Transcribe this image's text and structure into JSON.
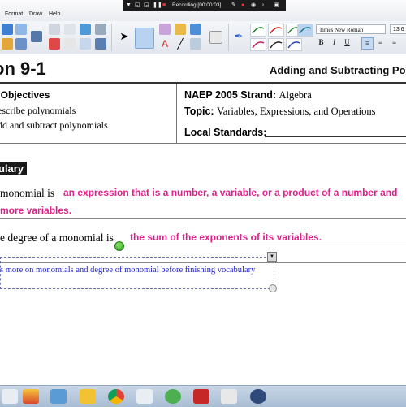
{
  "menubar": {
    "items": [
      "Format",
      "Draw",
      "Help"
    ]
  },
  "recording": {
    "status": "Recording [00:00:03]"
  },
  "toolbar": {
    "font_name": "Times New Roman",
    "font_size": "13.6",
    "bold": "B",
    "italic": "I",
    "underline": "U"
  },
  "worksheet": {
    "lesson_title": "on 9-1",
    "lesson_subtitle": "Adding and Subtracting Po",
    "objectives_heading": "n Objectives",
    "objective_1": "escribe polynomials",
    "objective_2": "dd and subtract polynomials",
    "naep_label": "NAEP 2005 Strand:",
    "naep_value": "Algebra",
    "topic_label": "Topic:",
    "topic_value": "Variables, Expressions, and Operations",
    "local_label": "Local Standards:",
    "vocab_heading": "ulary",
    "monomial_prompt": "monomial is",
    "monomial_answer_1": "an expression that is a number, a variable, or a product of a number and",
    "monomial_answer_2": " more variables.",
    "degree_prompt": "e degree of a monomial is",
    "degree_answer": "the sum of the exponents of its variables.",
    "annotation": "s more on monomials and degree of monomial before finishing vocabulary"
  },
  "colors": {
    "annotation_text": "#1c1fd0",
    "answer_pink": "#e0208a"
  }
}
